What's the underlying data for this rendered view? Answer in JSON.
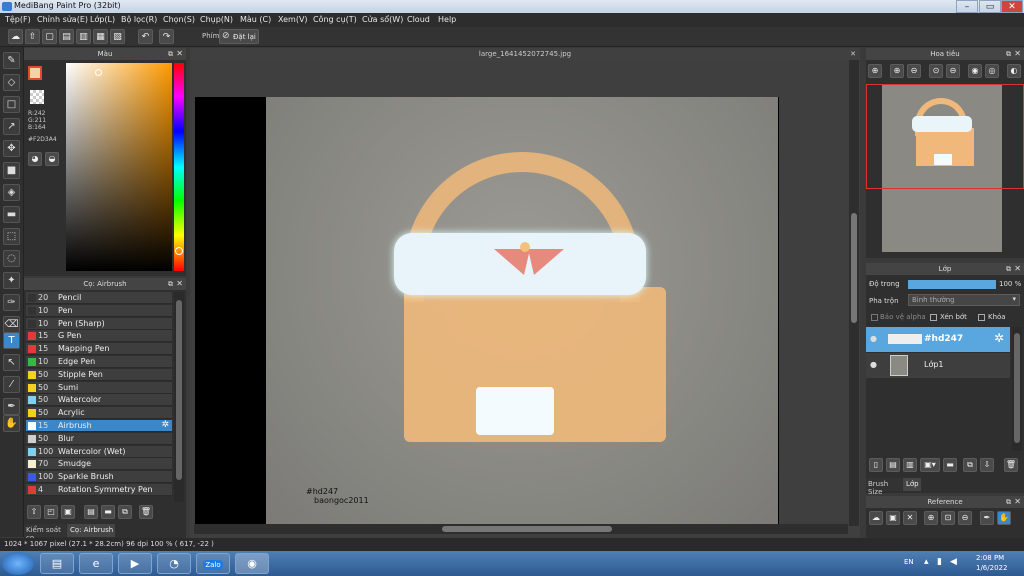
{
  "window": {
    "title": "MediBang Paint Pro (32bit)"
  },
  "menu": [
    "Tệp(F)",
    "Chỉnh sửa(E)",
    "Lớp(L)",
    "Bộ lọc(R)",
    "Chọn(S)",
    "Chụp(N)",
    "Màu (C)",
    "Xem(V)",
    "Công cụ(T)",
    "Cửa sổ(W)",
    "Cloud",
    "Help"
  ],
  "toolbar": {
    "key_label": "Phím",
    "reset_label": "Đặt lại"
  },
  "color_panel": {
    "title": "Màu",
    "r": "R:242",
    "g": "G:211",
    "b": "B:164",
    "hex": "#F2D3A4",
    "fg_color": "#F2D3A4"
  },
  "brush_panel": {
    "title": "Cọ: Airbrush",
    "items": [
      {
        "size": "20",
        "name": "Pencil",
        "color": "#333333"
      },
      {
        "size": "10",
        "name": "Pen",
        "color": "#333333"
      },
      {
        "size": "10",
        "name": "Pen (Sharp)",
        "color": "#333333"
      },
      {
        "size": "15",
        "name": "G Pen",
        "color": "#e03a3a"
      },
      {
        "size": "15",
        "name": "Mapping Pen",
        "color": "#e03a3a"
      },
      {
        "size": "10",
        "name": "Edge Pen",
        "color": "#3ab54a"
      },
      {
        "size": "50",
        "name": "Stipple Pen",
        "color": "#f5d020"
      },
      {
        "size": "50",
        "name": "Sumi",
        "color": "#f5d020"
      },
      {
        "size": "50",
        "name": "Watercolor",
        "color": "#7fd1f0"
      },
      {
        "size": "50",
        "name": "Acrylic",
        "color": "#f5d020"
      },
      {
        "size": "15",
        "name": "Airbrush",
        "color": "#ffffff",
        "selected": true
      },
      {
        "size": "50",
        "name": "Blur",
        "color": "#cfcfcf"
      },
      {
        "size": "100",
        "name": "Watercolor (Wet)",
        "color": "#7fd1f0"
      },
      {
        "size": "70",
        "name": "Smudge",
        "color": "#f5f0d0"
      },
      {
        "size": "100",
        "name": "Sparkle Brush",
        "color": "#3a5be0"
      },
      {
        "size": "4",
        "name": "Rotation Symmetry Pen",
        "color": "#e03a3a"
      }
    ],
    "tab1": "Kiểm soát cọ",
    "tab2": "Cọ: Airbrush"
  },
  "canvas": {
    "tab_title": "large_1641452072745.jpg",
    "watermark1": "#hd247",
    "watermark2": "baongoc2011"
  },
  "navigator": {
    "title": "Hoa tiêu"
  },
  "layer_panel": {
    "title": "Lớp",
    "opacity_label": "Độ trong",
    "opacity_value": "100 %",
    "opacity_fraction": 1.0,
    "blend_label": "Pha trộn",
    "blend_value": "Bình thường",
    "protect_alpha": "Bảo vệ alpha",
    "clipping": "Xén bớt",
    "lock": "Khóa",
    "layers": [
      {
        "name": "#hd247",
        "selected": true
      },
      {
        "name": "Lớp1",
        "selected": false
      }
    ],
    "tab_brush_size": "Brush Size",
    "tab_layer": "Lớp"
  },
  "reference": {
    "title": "Reference"
  },
  "status": {
    "text": "1024 * 1067 pixel   (27.1 * 28.2cm)   96 dpi   100 %   ( 617, -22 )"
  },
  "taskbar": {
    "lang": "EN",
    "time": "2:08 PM",
    "date": "1/6/2022",
    "zalo": "Zalo"
  }
}
